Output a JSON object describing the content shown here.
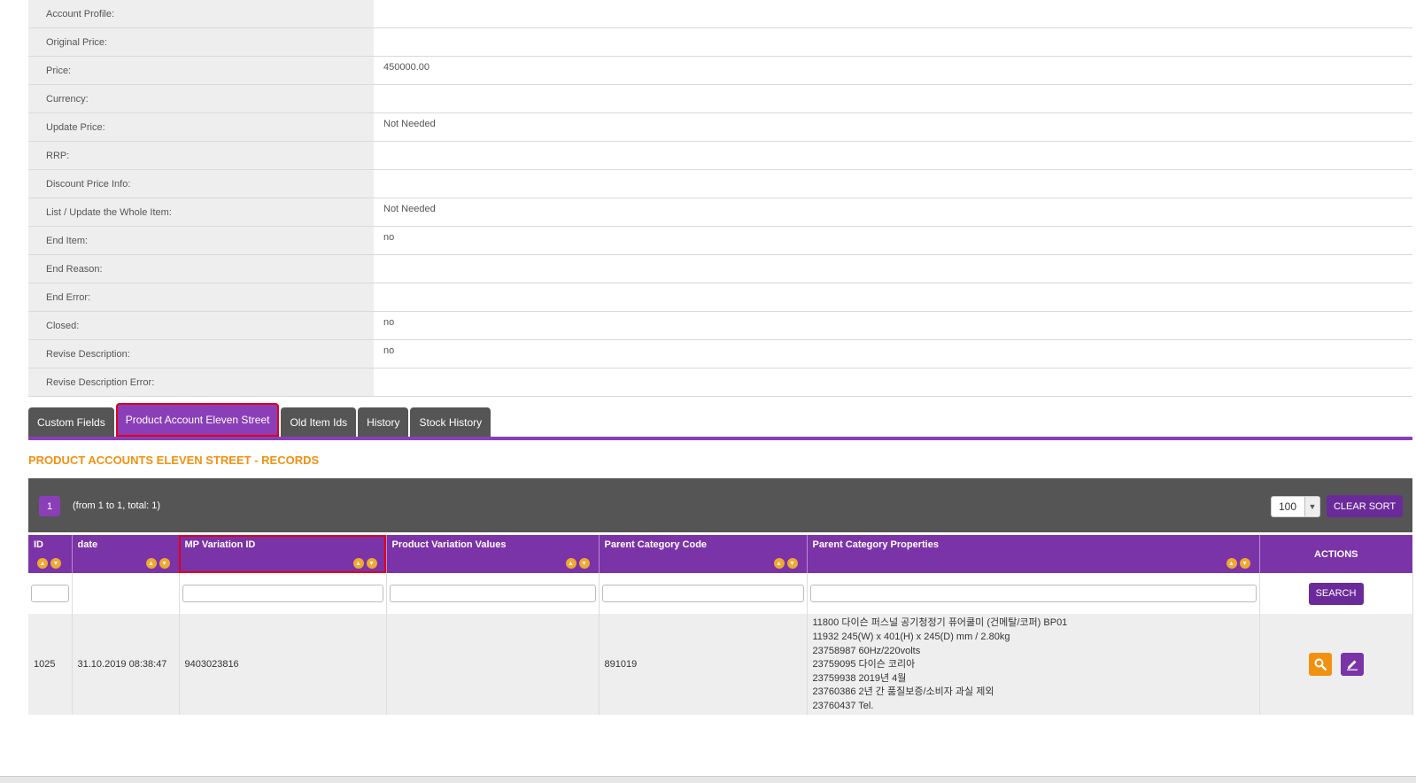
{
  "details": [
    {
      "label": "Account Profile:",
      "value": ""
    },
    {
      "label": "Original Price:",
      "value": ""
    },
    {
      "label": "Price:",
      "value": "450000.00"
    },
    {
      "label": "Currency:",
      "value": ""
    },
    {
      "label": "Update Price:",
      "value": "Not Needed"
    },
    {
      "label": "RRP:",
      "value": ""
    },
    {
      "label": "Discount Price Info:",
      "value": ""
    },
    {
      "label": "List / Update the Whole Item:",
      "value": "Not Needed"
    },
    {
      "label": "End Item:",
      "value": "no"
    },
    {
      "label": "End Reason:",
      "value": ""
    },
    {
      "label": "End Error:",
      "value": ""
    },
    {
      "label": "Closed:",
      "value": "no"
    },
    {
      "label": "Revise Description:",
      "value": "no"
    },
    {
      "label": "Revise Description Error:",
      "value": ""
    }
  ],
  "tabs": [
    {
      "label": "Custom Fields",
      "active": false
    },
    {
      "label": "Product Account Eleven Street",
      "active": true
    },
    {
      "label": "Old Item Ids",
      "active": false
    },
    {
      "label": "History",
      "active": false
    },
    {
      "label": "Stock History",
      "active": false
    }
  ],
  "section_title": "PRODUCT ACCOUNTS ELEVEN STREET - RECORDS",
  "toolbar": {
    "page": "1",
    "page_info": "(from 1 to 1, total: 1)",
    "page_size": "100",
    "clear_sort_label": "CLEAR SORT"
  },
  "columns": [
    {
      "label": "ID"
    },
    {
      "label": "date"
    },
    {
      "label": "MP Variation ID"
    },
    {
      "label": "Product Variation Values"
    },
    {
      "label": "Parent Category Code"
    },
    {
      "label": "Parent Category Properties"
    },
    {
      "label": "ACTIONS"
    }
  ],
  "search_label": "SEARCH",
  "rows": [
    {
      "id": "1025",
      "date": "31.10.2019 08:38:47",
      "mp_variation_id": "9403023816",
      "product_variation_values": "",
      "parent_category_code": "891019",
      "parent_category_properties": [
        "11800 다이슨 퍼스널 공기청정기 퓨어쿨미 (건메탈/코퍼) BP01",
        "11932 245(W) x 401(H) x 245(D) mm / 2.80kg",
        "23758987 60Hz/220volts",
        "23759095 다이슨 코리아",
        "23759938 2019년 4월",
        "23760386 2년 간 품질보증/소비자 과실 제외",
        "23760437 Tel."
      ]
    }
  ],
  "colors": {
    "purple": "#7b33a8",
    "orange": "#f29111",
    "dark_gray": "#555555",
    "highlight_red": "#e0001a"
  },
  "icons": {
    "view": "magnifier-icon",
    "edit": "pencil-icon",
    "sort_asc": "sort-up-icon",
    "sort_desc": "sort-down-icon"
  }
}
